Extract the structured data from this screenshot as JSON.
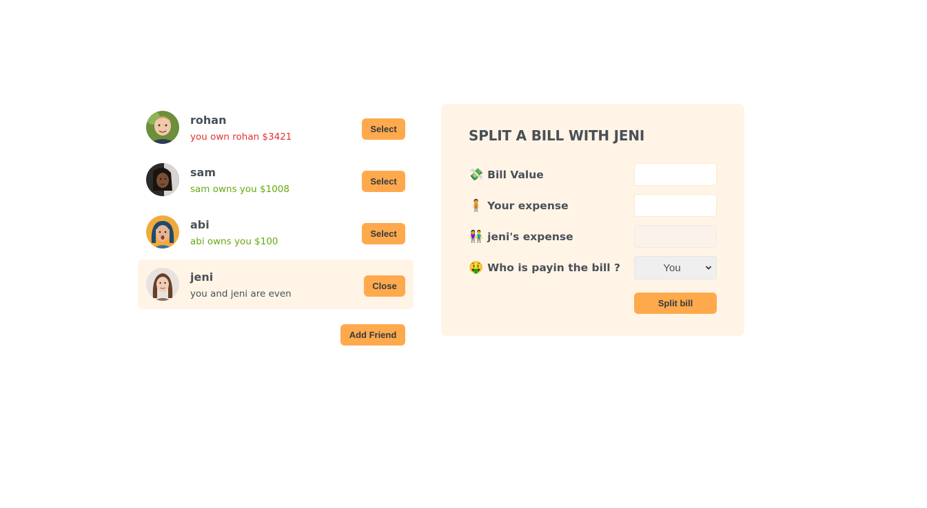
{
  "friends": [
    {
      "name": "rohan",
      "balance_text": "you own rohan $3421",
      "status": "red",
      "button_label": "Select",
      "avatar_icon": "boy-avatar-icon"
    },
    {
      "name": "sam",
      "balance_text": "sam owns you $1008",
      "status": "green",
      "button_label": "Select",
      "avatar_icon": "girl-avatar-icon"
    },
    {
      "name": "abi",
      "balance_text": "abi owns you $100",
      "status": "green",
      "button_label": "Select",
      "avatar_icon": "woman-avatar-icon"
    },
    {
      "name": "jeni",
      "balance_text": "you and jeni are even",
      "status": "neutral",
      "button_label": "Close",
      "selected": true,
      "avatar_icon": "woman-avatar-icon"
    }
  ],
  "add_friend_label": "Add Friend",
  "split_form": {
    "title": "SPLIT A BILL WITH JENI",
    "bill_value": {
      "emoji": "💸",
      "label": "Bill Value",
      "value": ""
    },
    "your_expense": {
      "emoji": "🧍",
      "label": "Your expense",
      "value": ""
    },
    "friend_expense": {
      "emoji": "👫",
      "label": "jeni's expense",
      "value": ""
    },
    "payer": {
      "emoji": "🤑",
      "label": "Who is payin the bill ?",
      "selected": "You"
    },
    "submit_label": "Split bill"
  },
  "colors": {
    "accent": "#ffa94d",
    "light_bg": "#fff4e6",
    "owe_red": "#e03131",
    "owed_green": "#66a80f",
    "text": "#495057"
  }
}
